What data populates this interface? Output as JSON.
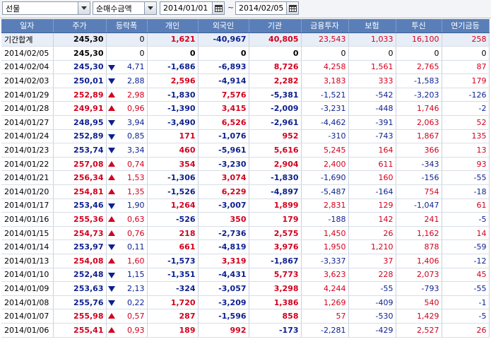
{
  "toolbar": {
    "market_select": "선물",
    "type_select": "순매수금액",
    "start_date": "2014/01/01",
    "end_date": "2014/02/05",
    "separator": "~",
    "icons": {
      "dropdown": "chevron-down-icon",
      "calendar": "calendar-icon"
    }
  },
  "colors": {
    "up": "#d2001e",
    "down": "#0b1f8f",
    "header": "#5a7fb8"
  },
  "table": {
    "headers": [
      "일자",
      "주가",
      "등락폭",
      "개인",
      "외국인",
      "기관",
      "금융투자",
      "보험",
      "투신",
      "연기금등"
    ],
    "summary": {
      "date": "기간합계",
      "price": "245,30",
      "change": "0",
      "dir": "none",
      "vals": [
        "1,621",
        "-40,967",
        "40,805",
        "23,543",
        "1,033",
        "16,100",
        "258"
      ]
    },
    "rows": [
      {
        "date": "2014/02/05",
        "price": "245,30",
        "change": "0",
        "dir": "none",
        "vals": [
          "0",
          "0",
          "0",
          "0",
          "0",
          "0",
          "0"
        ]
      },
      {
        "date": "2014/02/04",
        "price": "245,30",
        "change": "4,71",
        "dir": "down",
        "vals": [
          "-1,686",
          "-6,893",
          "8,726",
          "4,258",
          "1,561",
          "2,765",
          "87"
        ]
      },
      {
        "date": "2014/02/03",
        "price": "250,01",
        "change": "2,88",
        "dir": "down",
        "vals": [
          "2,596",
          "-4,914",
          "2,282",
          "3,183",
          "333",
          "-1,583",
          "179"
        ]
      },
      {
        "date": "2014/01/29",
        "price": "252,89",
        "change": "2,98",
        "dir": "up",
        "vals": [
          "-1,830",
          "7,576",
          "-5,381",
          "-1,521",
          "-542",
          "-3,203",
          "-126"
        ]
      },
      {
        "date": "2014/01/28",
        "price": "249,91",
        "change": "0,96",
        "dir": "up",
        "vals": [
          "-1,390",
          "3,415",
          "-2,009",
          "-3,231",
          "-448",
          "1,746",
          "-2"
        ]
      },
      {
        "date": "2014/01/27",
        "price": "248,95",
        "change": "3,94",
        "dir": "down",
        "vals": [
          "-3,490",
          "6,526",
          "-2,961",
          "-4,462",
          "-391",
          "2,063",
          "52"
        ]
      },
      {
        "date": "2014/01/24",
        "price": "252,89",
        "change": "0,85",
        "dir": "down",
        "vals": [
          "171",
          "-1,076",
          "952",
          "-310",
          "-743",
          "1,867",
          "135"
        ]
      },
      {
        "date": "2014/01/23",
        "price": "253,74",
        "change": "3,34",
        "dir": "down",
        "vals": [
          "460",
          "-5,961",
          "5,616",
          "5,245",
          "164",
          "366",
          "13"
        ]
      },
      {
        "date": "2014/01/22",
        "price": "257,08",
        "change": "0,74",
        "dir": "up",
        "vals": [
          "354",
          "-3,230",
          "2,904",
          "2,400",
          "611",
          "-343",
          "93"
        ]
      },
      {
        "date": "2014/01/21",
        "price": "256,34",
        "change": "1,53",
        "dir": "up",
        "vals": [
          "-1,306",
          "3,074",
          "-1,830",
          "-1,690",
          "160",
          "-156",
          "-55"
        ]
      },
      {
        "date": "2014/01/20",
        "price": "254,81",
        "change": "1,35",
        "dir": "up",
        "vals": [
          "-1,526",
          "6,229",
          "-4,897",
          "-5,487",
          "-164",
          "754",
          "-18"
        ]
      },
      {
        "date": "2014/01/17",
        "price": "253,46",
        "change": "1,90",
        "dir": "down",
        "vals": [
          "1,264",
          "-3,007",
          "1,899",
          "2,831",
          "129",
          "-1,047",
          "61"
        ]
      },
      {
        "date": "2014/01/16",
        "price": "255,36",
        "change": "0,63",
        "dir": "up",
        "vals": [
          "-526",
          "350",
          "179",
          "-188",
          "142",
          "241",
          "-5"
        ]
      },
      {
        "date": "2014/01/15",
        "price": "254,73",
        "change": "0,76",
        "dir": "up",
        "vals": [
          "218",
          "-2,736",
          "2,575",
          "1,450",
          "26",
          "1,162",
          "14"
        ]
      },
      {
        "date": "2014/01/14",
        "price": "253,97",
        "change": "0,11",
        "dir": "down",
        "vals": [
          "661",
          "-4,819",
          "3,976",
          "1,950",
          "1,210",
          "878",
          "-59"
        ]
      },
      {
        "date": "2014/01/13",
        "price": "254,08",
        "change": "1,60",
        "dir": "up",
        "vals": [
          "-1,573",
          "3,319",
          "-1,867",
          "-3,337",
          "37",
          "1,406",
          "-12"
        ]
      },
      {
        "date": "2014/01/10",
        "price": "252,48",
        "change": "1,15",
        "dir": "down",
        "vals": [
          "-1,351",
          "-4,431",
          "5,773",
          "3,623",
          "228",
          "2,073",
          "45"
        ]
      },
      {
        "date": "2014/01/09",
        "price": "253,63",
        "change": "2,13",
        "dir": "down",
        "vals": [
          "-324",
          "-3,057",
          "3,298",
          "4,244",
          "-55",
          "-793",
          "-55"
        ]
      },
      {
        "date": "2014/01/08",
        "price": "255,76",
        "change": "0,22",
        "dir": "down",
        "vals": [
          "1,720",
          "-3,209",
          "1,386",
          "1,269",
          "-409",
          "540",
          "-1"
        ]
      },
      {
        "date": "2014/01/07",
        "price": "255,98",
        "change": "0,57",
        "dir": "up",
        "vals": [
          "287",
          "-1,596",
          "858",
          "57",
          "-530",
          "1,429",
          "-5"
        ]
      },
      {
        "date": "2014/01/06",
        "price": "255,41",
        "change": "0,93",
        "dir": "up",
        "vals": [
          "189",
          "992",
          "-173",
          "-2,281",
          "-429",
          "2,527",
          "26"
        ]
      }
    ]
  }
}
